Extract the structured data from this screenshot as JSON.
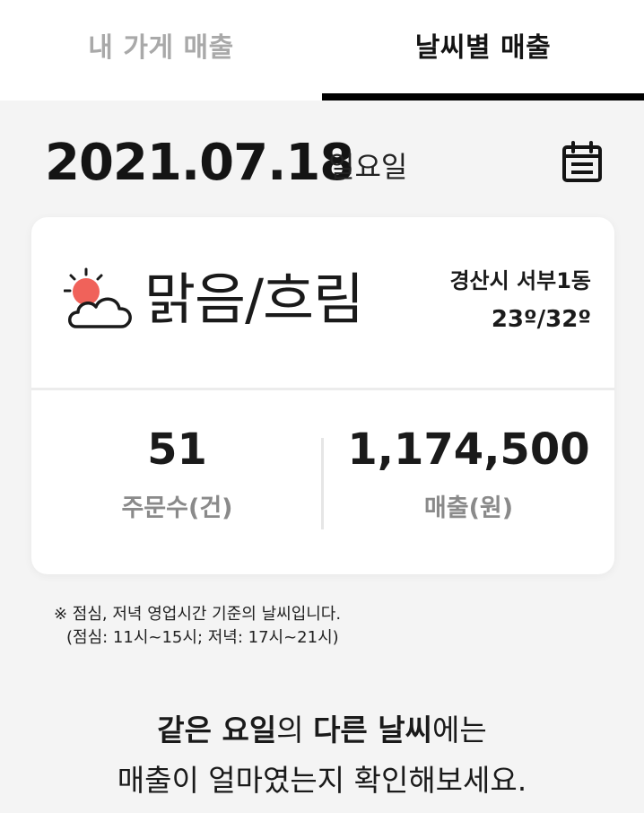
{
  "tabs": [
    {
      "label": "내 가게 매출",
      "active": false
    },
    {
      "label": "날씨별 매출",
      "active": true
    }
  ],
  "date": {
    "value": "2021.07.18",
    "day": "일요일"
  },
  "icons": {
    "calendar": "calendar-icon",
    "weather": "partly-cloudy-icon"
  },
  "colors": {
    "sun": "#f0625a",
    "active_tab_underline": "#000000",
    "muted_text": "#8a8a8a"
  },
  "weather": {
    "label": "맑음/흐림",
    "location": "경산시 서부1동",
    "temps": "23º/32º"
  },
  "stats": {
    "orders": {
      "value": "51",
      "label": "주문수(건)"
    },
    "sales": {
      "value": "1,174,500",
      "label": "매출(원)"
    }
  },
  "note": {
    "line1": "※ 점심, 저녁 영업시간 기준의 날씨입니다.",
    "line2": "(점심: 11시~15시; 저녁: 17시~21시)"
  },
  "message": {
    "line1_bold_1": "같은 요일",
    "line1_text_1": "의 ",
    "line1_bold_2": "다른 날씨",
    "line1_text_2": "에는",
    "line2": "매출이 얼마였는지 확인해보세요."
  }
}
